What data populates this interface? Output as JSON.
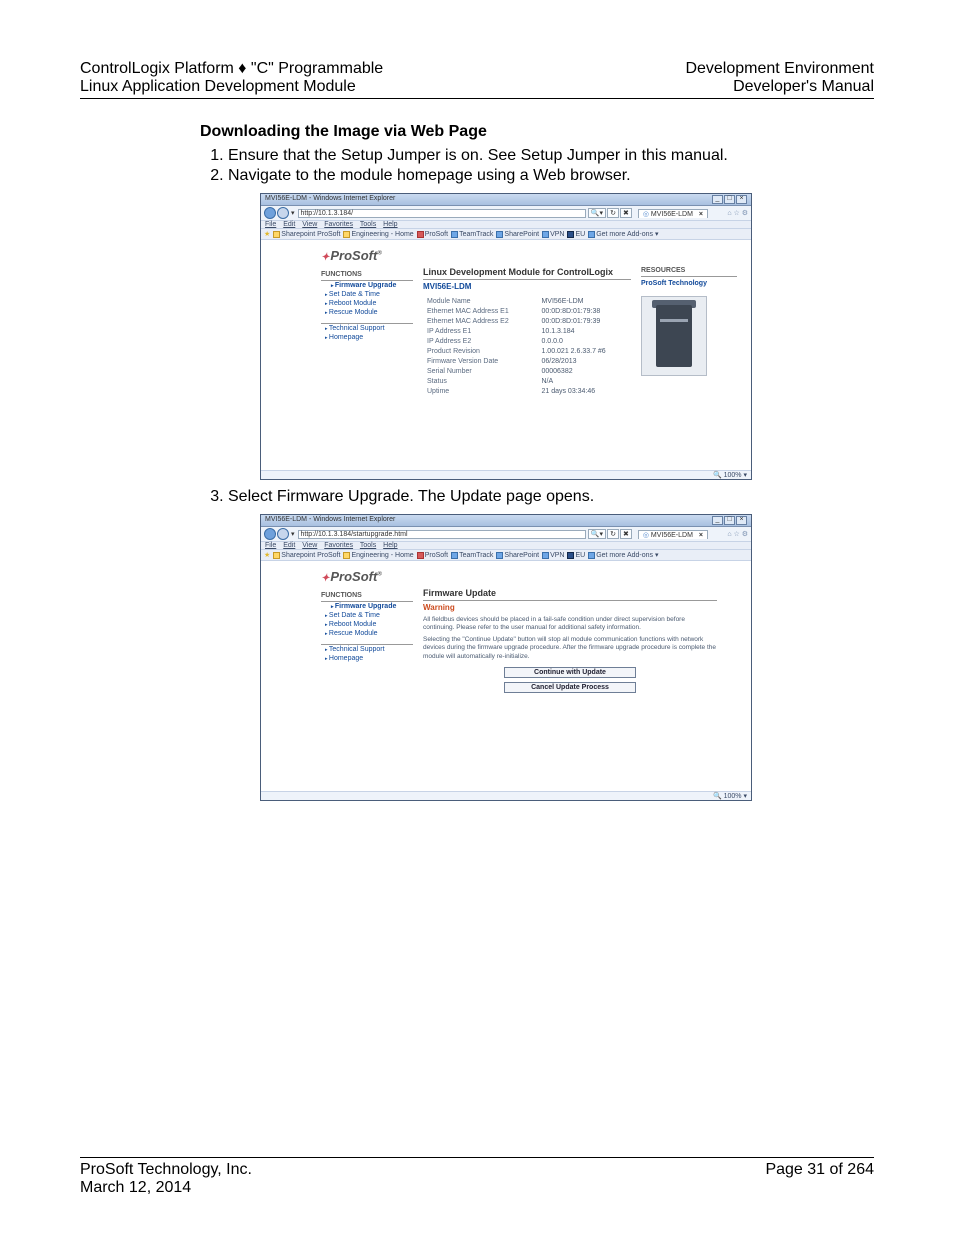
{
  "header": {
    "left1": "ControlLogix Platform ♦ \"C\" Programmable",
    "left2": "Linux Application Development Module",
    "right1": "Development Environment",
    "right2": "Developer's Manual"
  },
  "section_title": "Downloading the Image via Web Page",
  "steps": [
    "Ensure that the Setup Jumper is on. See Setup Jumper in this manual.",
    "Navigate to the module homepage using a Web browser.",
    "Select Firmware Upgrade.   The Update page opens."
  ],
  "ie": {
    "title": "MVI56E-LDM - Windows Internet Explorer",
    "zoom": "100%",
    "tab_label": "MVI56E-LDM",
    "menu": [
      "File",
      "Edit",
      "View",
      "Favorites",
      "Tools",
      "Help"
    ],
    "favbar": [
      "Sharepoint ProSoft",
      "Engineering - Home",
      "ProSoft",
      "TeamTrack",
      "SharePoint",
      "VPN",
      "EU",
      "Get more Add-ons ▾"
    ]
  },
  "shot1": {
    "url": "http://10.1.3.184/",
    "main_title": "Linux Development Module for ControlLogix",
    "model": "MVI56E-LDM",
    "resources_hdr": "RESOURCES",
    "resources_link": "ProSoft Technology",
    "sidebar": {
      "hdr": "FUNCTIONS",
      "items": [
        "Firmware Upgrade",
        "Set Date & Time",
        "Reboot Module",
        "Rescue Module"
      ],
      "items2": [
        "Technical Support",
        "Homepage"
      ]
    },
    "rows": [
      [
        "Module Name",
        "MVI56E-LDM"
      ],
      [
        "Ethernet MAC Address E1",
        "00:0D:8D:01:79:38"
      ],
      [
        "Ethernet MAC Address E2",
        "00:0D:8D:01:79:39"
      ],
      [
        "IP Address E1",
        "10.1.3.184"
      ],
      [
        "IP Address E2",
        "0.0.0.0"
      ],
      [
        "Product Revision",
        "1.00.021   2.6.33.7 #6"
      ],
      [
        "Firmware Version Date",
        "06/28/2013"
      ],
      [
        "Serial Number",
        "00006382"
      ],
      [
        "Status",
        "N/A"
      ],
      [
        "Uptime",
        "21 days 03:34:46"
      ]
    ]
  },
  "shot2": {
    "url": "http://10.1.3.184/startupgrade.html",
    "main_title": "Firmware Update",
    "warning_label": "Warning",
    "warn1": "All fieldbus devices should be placed in a fail-safe condition under direct supervision before continuing. Please refer to the user manual for additional safety information.",
    "warn2": "Selecting the \"Continue Update\" button will stop all module communication functions with network devices during the firmware upgrade procedure. After the firmware upgrade procedure is complete the module will automatically re-initialize.",
    "btn_continue": "Continue with Update",
    "btn_cancel": "Cancel Update Process",
    "sidebar": {
      "hdr": "FUNCTIONS",
      "items": [
        "Firmware Upgrade",
        "Set Date & Time",
        "Reboot Module",
        "Rescue Module"
      ],
      "items2": [
        "Technical Support",
        "Homepage"
      ]
    }
  },
  "footer": {
    "company": "ProSoft Technology, Inc.",
    "date": "March 12, 2014",
    "page": "Page 31 of 264"
  }
}
